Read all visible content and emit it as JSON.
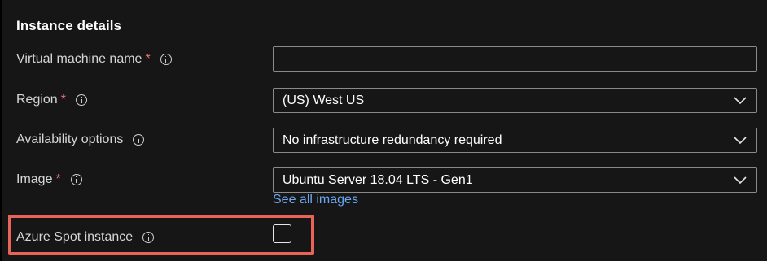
{
  "section": {
    "title": "Instance details"
  },
  "fields": {
    "vm_name": {
      "label": "Virtual machine name",
      "required_mark": "*",
      "value": "",
      "placeholder": ""
    },
    "region": {
      "label": "Region",
      "required_mark": "*",
      "value": "(US) West US"
    },
    "availability": {
      "label": "Availability options",
      "value": "No infrastructure redundancy required"
    },
    "image": {
      "label": "Image",
      "required_mark": "*",
      "value": "Ubuntu Server 18.04 LTS - Gen1",
      "link": "See all images"
    },
    "spot": {
      "label": "Azure Spot instance",
      "checked": false
    }
  },
  "icons": {
    "info": "info-icon",
    "dropdown": "chevron-down-icon"
  },
  "colors": {
    "background": "#161616",
    "text": "#d6d6d6",
    "required": "#f1707b",
    "link": "#6aa6f2",
    "highlight": "#e76457",
    "field_border": "#8a8a8a"
  }
}
